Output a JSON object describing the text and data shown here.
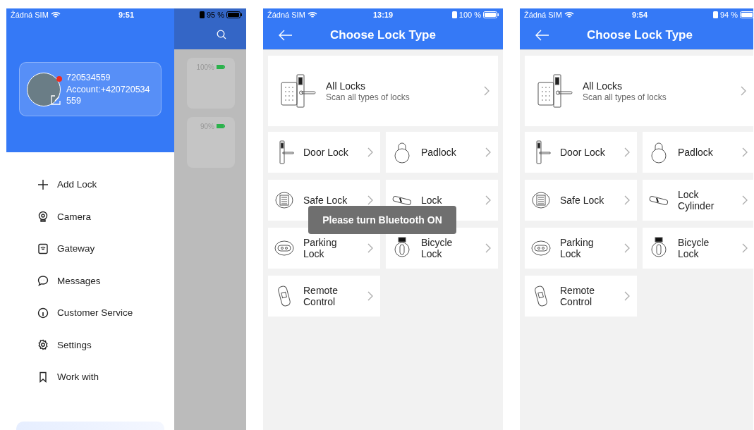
{
  "screens": [
    {
      "kind": "drawer",
      "status_bar": {
        "carrier": "Žádná SIM",
        "time": "9:51",
        "battery": "95 %"
      },
      "profile": {
        "name": "720534559",
        "account": "Account:+420720534559",
        "notification": true
      },
      "menu": [
        {
          "label": "Add Lock"
        },
        {
          "label": "Camera"
        },
        {
          "label": "Gateway"
        },
        {
          "label": "Messages"
        },
        {
          "label": "Customer Service"
        },
        {
          "label": "Settings"
        },
        {
          "label": "Work with"
        }
      ],
      "behind_cards": [
        {
          "battery": "100%"
        },
        {
          "battery": "90%"
        }
      ]
    },
    {
      "kind": "lock_types",
      "status_bar": {
        "carrier": "Žádná SIM",
        "time": "13:19",
        "battery": "100 %"
      },
      "title": "Choose Lock Type",
      "featured": {
        "title": "All Locks",
        "subtitle": "Scan all types of locks"
      },
      "tiles": [
        {
          "label": "Door Lock"
        },
        {
          "label": "Padlock"
        },
        {
          "label": "Safe Lock"
        },
        {
          "label": "Lock"
        },
        {
          "label": "Parking Lock"
        },
        {
          "label": "Bicycle Lock"
        },
        {
          "label": "Remote Control"
        }
      ],
      "toast": "Please turn Bluetooth ON"
    },
    {
      "kind": "lock_types",
      "status_bar": {
        "carrier": "Žádná SIM",
        "time": "9:54",
        "battery": "94 %"
      },
      "title": "Choose Lock Type",
      "featured": {
        "title": "All Locks",
        "subtitle": "Scan all types of locks"
      },
      "tiles": [
        {
          "label": "Door Lock"
        },
        {
          "label": "Padlock"
        },
        {
          "label": "Safe Lock"
        },
        {
          "label": "Lock Cylinder"
        },
        {
          "label": "Parking Lock"
        },
        {
          "label": "Bicycle Lock"
        },
        {
          "label": "Remote Control"
        }
      ]
    }
  ]
}
